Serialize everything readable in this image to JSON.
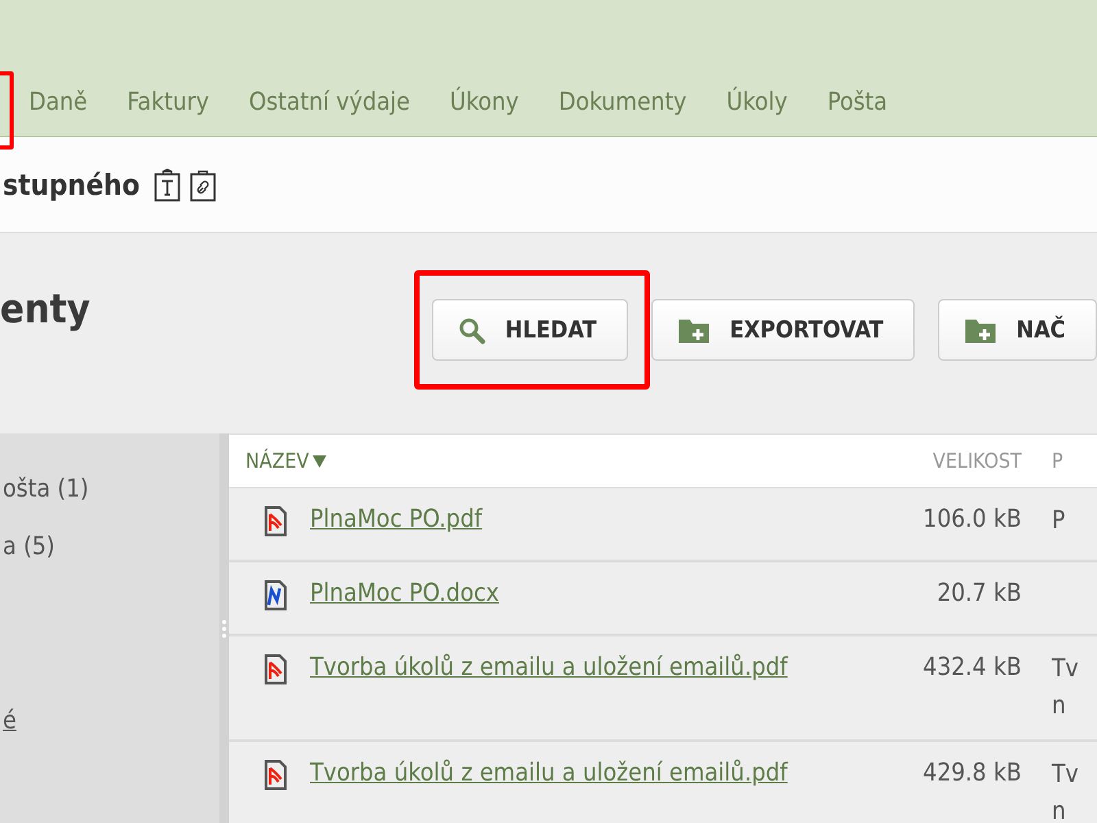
{
  "nav": {
    "leading_highlight": true,
    "items": [
      {
        "label": "Daně"
      },
      {
        "label": "Faktury"
      },
      {
        "label": "Ostatní výdaje"
      },
      {
        "label": "Úkony"
      },
      {
        "label": "Dokumenty"
      },
      {
        "label": "Úkoly"
      },
      {
        "label": "Pošta"
      }
    ]
  },
  "title_bar": {
    "title": "stupného"
  },
  "section": {
    "heading": "enty"
  },
  "buttons": [
    {
      "label": "HLEDAT",
      "kind": "search",
      "highlighted": true
    },
    {
      "label": "EXPORTOVAT",
      "kind": "folder-add",
      "highlighted": false
    },
    {
      "label": "NAČ",
      "kind": "folder-add",
      "highlighted": false
    }
  ],
  "sidebar": {
    "items": [
      {
        "label": "ošta (1)",
        "kind": "plain"
      },
      {
        "label": "a (5)",
        "kind": "plain"
      },
      {
        "label": "é",
        "kind": "link"
      }
    ]
  },
  "table": {
    "columns": [
      {
        "label": "NÁZEV",
        "sorted": true
      },
      {
        "label": "VELIKOST",
        "sorted": false
      },
      {
        "label": "P",
        "sorted": false
      }
    ],
    "rows": [
      {
        "kind": "pdf",
        "name": "PlnaMoc PO.pdf",
        "size": "106.0 kB",
        "column_3": [
          "P"
        ]
      },
      {
        "kind": "docx",
        "name": "PlnaMoc PO.docx",
        "size": "20.7 kB",
        "column_3": []
      },
      {
        "kind": "pdf",
        "name": "Tvorba úkolů z emailu a uložení emailů.pdf",
        "size": "432.4 kB",
        "column_3": [
          "Tv",
          "n"
        ]
      },
      {
        "kind": "pdf",
        "name": "Tvorba úkolů z emailu a uložení emailů.pdf",
        "size": "429.8 kB",
        "column_3": [
          "Tv",
          "n"
        ]
      }
    ]
  }
}
